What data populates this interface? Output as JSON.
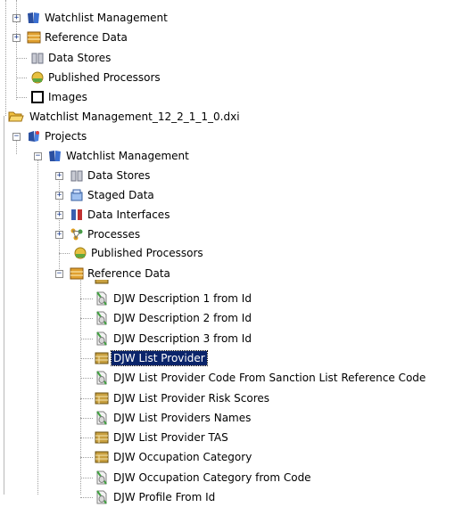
{
  "tree": {
    "top_watchlist": {
      "label": "Watchlist Management",
      "icon": "book-icon"
    },
    "top_reference": {
      "label": "Reference Data",
      "icon": "reference-data-icon"
    },
    "top_datastores": {
      "label": "Data Stores",
      "icon": "data-stores-icon"
    },
    "top_published": {
      "label": "Published Processors",
      "icon": "processor-icon"
    },
    "top_images": {
      "label": "Images",
      "icon": "images-icon"
    },
    "file": {
      "label": "Watchlist Management_12_2_1_1_0.dxi",
      "icon": "folder-open-icon"
    },
    "projects": {
      "label": "Projects",
      "icon": "projects-icon"
    },
    "project": {
      "label": "Watchlist Management",
      "icon": "book-icon"
    },
    "datastores": {
      "label": "Data Stores",
      "icon": "data-stores-icon"
    },
    "staged": {
      "label": "Staged Data",
      "icon": "staged-data-icon"
    },
    "interfaces": {
      "label": "Data Interfaces",
      "icon": "data-interfaces-icon"
    },
    "processes": {
      "label": "Processes",
      "icon": "processes-icon"
    },
    "published": {
      "label": "Published Processors",
      "icon": "processor-icon"
    },
    "reference": {
      "label": "Reference Data",
      "icon": "reference-data-icon"
    },
    "items": [
      {
        "label": "DJW Description 1 from Id",
        "icon": "lookup-icon"
      },
      {
        "label": "DJW Description 2 from Id",
        "icon": "lookup-icon"
      },
      {
        "label": "DJW Description 3 from Id",
        "icon": "lookup-icon"
      },
      {
        "label": "DJW List Provider",
        "icon": "table-icon",
        "selected": true
      },
      {
        "label": "DJW List Provider Code From Sanction List Reference Code",
        "icon": "lookup-icon"
      },
      {
        "label": "DJW List Provider Risk Scores",
        "icon": "table-icon"
      },
      {
        "label": "DJW List Providers Names",
        "icon": "lookup-icon"
      },
      {
        "label": "DJW List Provider TAS",
        "icon": "table-icon"
      },
      {
        "label": "DJW Occupation Category",
        "icon": "table-icon"
      },
      {
        "label": "DJW Occupation Category from Code",
        "icon": "lookup-icon"
      },
      {
        "label": "DJW Profile From Id",
        "icon": "lookup-icon"
      }
    ]
  },
  "colors": {
    "selection": "#0a246a",
    "connector": "#a0a0a0",
    "expander": "#1a3a8a"
  }
}
